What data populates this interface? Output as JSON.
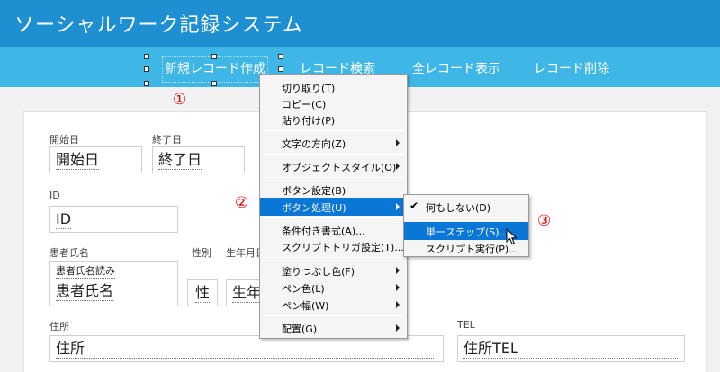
{
  "app": {
    "title": "ソーシャルワーク記録システム"
  },
  "nav": {
    "new_record": "新規レコード作成",
    "search_record": "レコード検索",
    "show_all": "全レコード表示",
    "delete_record": "レコード削除"
  },
  "form": {
    "start_date_label": "開始日",
    "start_date_value": "開始日",
    "end_date_label": "終了日",
    "end_date_value": "終了日",
    "id_label": "ID",
    "id_value": "ID",
    "patient_name_label": "患者氏名",
    "patient_name_kana": "患者氏名読み",
    "patient_name_value": "患者氏名",
    "gender_label": "性別",
    "gender_value": "性",
    "birth_label": "生年月日",
    "birth_value": "生年",
    "address_label": "住所",
    "address_value": "住所",
    "tel_label": "TEL",
    "tel_value": "住所TEL"
  },
  "markers": {
    "one": "①",
    "two": "②",
    "three": "③"
  },
  "context_menu": {
    "cut": "切り取り(T)",
    "copy": "コピー(C)",
    "paste": "貼り付け(P)",
    "text_direction": "文字の方向(Z)",
    "object_style": "オブジェクトスタイル(O)",
    "button_settings": "ボタン設定(B)",
    "button_action": "ボタン処理(U)",
    "conditional_format": "条件付き書式(A)...",
    "script_triggers": "スクリプトトリガ設定(T)...",
    "fill_color": "塗りつぶし色(F)",
    "pen_color": "ペン色(L)",
    "pen_width": "ペン幅(W)",
    "arrange": "配置(G)"
  },
  "submenu": {
    "do_nothing": "何もしない(D)",
    "single_step": "単一ステップ(S)...",
    "run_script": "スクリプト実行(P)..."
  },
  "colors": {
    "title_bar": "#1e8fd0",
    "nav_bar": "#3eb6e6",
    "highlight": "#0a76d6",
    "marker": "#e60000"
  }
}
